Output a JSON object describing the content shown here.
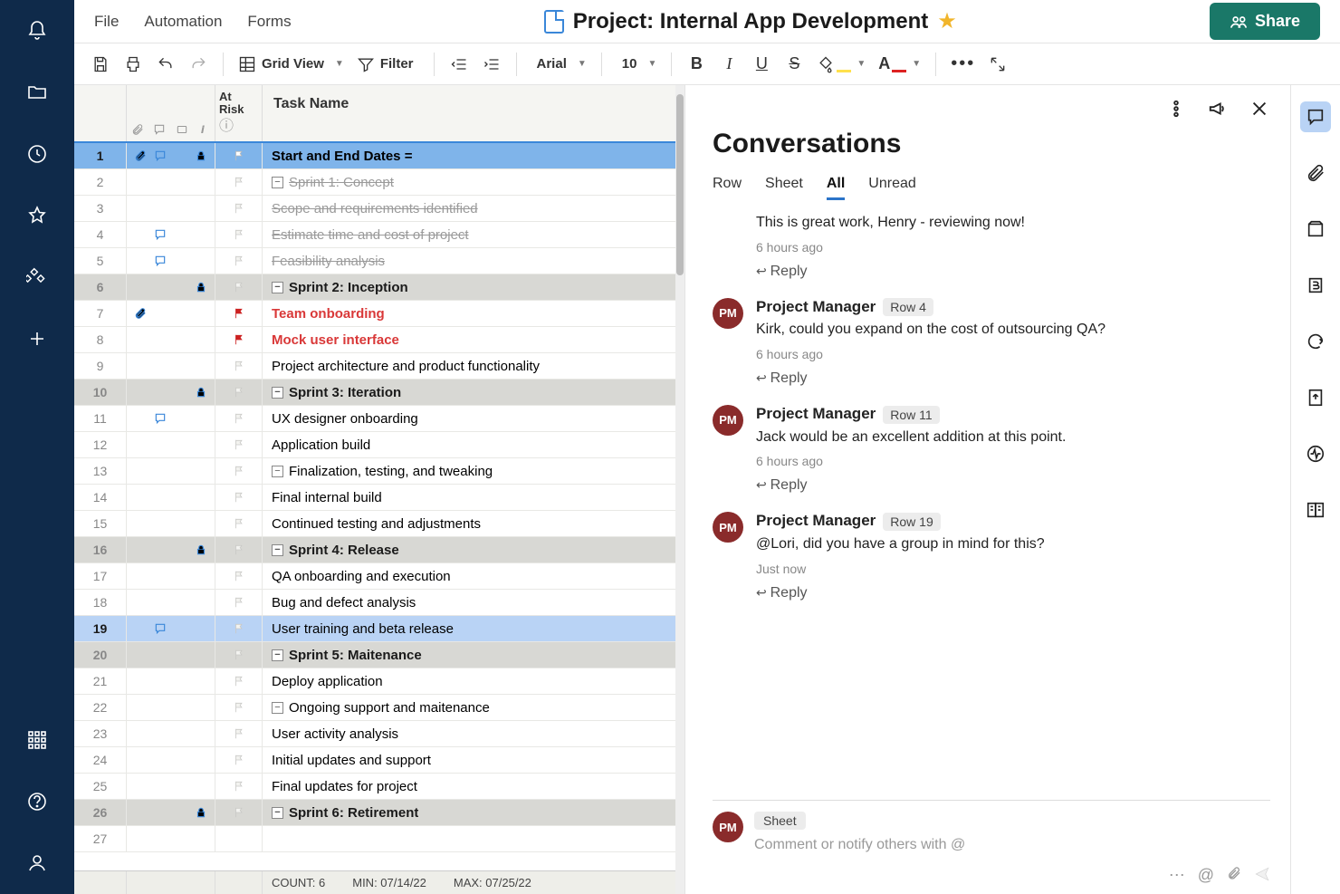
{
  "menu": {
    "file": "File",
    "automation": "Automation",
    "forms": "Forms"
  },
  "title": "Project: Internal App Development",
  "share": "Share",
  "toolbar": {
    "gridview": "Grid View",
    "filter": "Filter",
    "font": "Arial",
    "size": "10"
  },
  "gridHeaders": {
    "risk": "At Risk",
    "task": "Task Name"
  },
  "rows": [
    {
      "n": 1,
      "text": "Start and End Dates =",
      "style": "selected-blue",
      "indent": 0,
      "bold": true,
      "attach": true,
      "comment": true,
      "lock": true,
      "flag": "white",
      "exp": null
    },
    {
      "n": 2,
      "text": "Sprint 1: Concept",
      "style": "",
      "indent": 1,
      "strike": true,
      "exp": "-",
      "flag": "outline"
    },
    {
      "n": 3,
      "text": "Scope and requirements identified",
      "style": "",
      "indent": 2,
      "strike": true,
      "flag": "outline"
    },
    {
      "n": 4,
      "text": "Estimate time and cost of project",
      "style": "",
      "indent": 2,
      "strike": true,
      "comment": true,
      "flag": "outline"
    },
    {
      "n": 5,
      "text": "Feasibility analysis",
      "style": "",
      "indent": 2,
      "strike": true,
      "comment": true,
      "flag": "outline"
    },
    {
      "n": 6,
      "text": "Sprint 2: Inception",
      "style": "hdr",
      "indent": 1,
      "bold": true,
      "lock": true,
      "exp": "-",
      "flag": "outline"
    },
    {
      "n": 7,
      "text": "Team onboarding",
      "style": "",
      "indent": 2,
      "red": true,
      "attach": true,
      "flag": "red"
    },
    {
      "n": 8,
      "text": "Mock user interface",
      "style": "",
      "indent": 2,
      "red": true,
      "flag": "red"
    },
    {
      "n": 9,
      "text": "Project architecture and product functionality",
      "style": "",
      "indent": 2,
      "flag": "outline"
    },
    {
      "n": 10,
      "text": "Sprint 3: Iteration",
      "style": "hdr",
      "indent": 1,
      "bold": true,
      "lock": true,
      "exp": "-",
      "flag": "outline"
    },
    {
      "n": 11,
      "text": "UX designer onboarding",
      "style": "",
      "indent": 2,
      "comment": true,
      "flag": "outline"
    },
    {
      "n": 12,
      "text": "Application build",
      "style": "",
      "indent": 2,
      "flag": "outline"
    },
    {
      "n": 13,
      "text": "Finalization, testing, and tweaking",
      "style": "",
      "indent": 2,
      "exp": "-",
      "flag": "outline"
    },
    {
      "n": 14,
      "text": "Final internal build",
      "style": "",
      "indent": 3,
      "flag": "outline"
    },
    {
      "n": 15,
      "text": "Continued testing and adjustments",
      "style": "",
      "indent": 3,
      "flag": "outline"
    },
    {
      "n": 16,
      "text": "Sprint 4: Release",
      "style": "hdr",
      "indent": 1,
      "bold": true,
      "lock": true,
      "exp": "-",
      "flag": "outline"
    },
    {
      "n": 17,
      "text": "QA onboarding and execution",
      "style": "",
      "indent": 2,
      "flag": "outline"
    },
    {
      "n": 18,
      "text": "Bug and defect analysis",
      "style": "",
      "indent": 2,
      "flag": "outline"
    },
    {
      "n": 19,
      "text": "User training and beta release",
      "style": "current",
      "indent": 2,
      "comment": true,
      "flag": "outline"
    },
    {
      "n": 20,
      "text": "Sprint 5: Maitenance",
      "style": "hdr",
      "indent": 1,
      "bold": true,
      "exp": "-",
      "flag": "outline"
    },
    {
      "n": 21,
      "text": "Deploy application",
      "style": "",
      "indent": 2,
      "flag": "outline"
    },
    {
      "n": 22,
      "text": "Ongoing support and maitenance",
      "style": "",
      "indent": 2,
      "exp": "-",
      "flag": "outline"
    },
    {
      "n": 23,
      "text": "User activity analysis",
      "style": "",
      "indent": 3,
      "flag": "outline"
    },
    {
      "n": 24,
      "text": "Initial updates and support",
      "style": "",
      "indent": 3,
      "flag": "outline"
    },
    {
      "n": 25,
      "text": "Final updates for project",
      "style": "",
      "indent": 2,
      "flag": "outline"
    },
    {
      "n": 26,
      "text": "Sprint 6: Retirement",
      "style": "hdr",
      "indent": 1,
      "bold": true,
      "lock": true,
      "exp": "-",
      "flag": "outline"
    },
    {
      "n": 27,
      "text": "",
      "style": "",
      "indent": 2
    }
  ],
  "footer": {
    "count": "COUNT:  6",
    "min": "MIN:  07/14/22",
    "max": "MAX:  07/25/22"
  },
  "conversations": {
    "title": "Conversations",
    "tabs": {
      "row": "Row",
      "sheet": "Sheet",
      "all": "All",
      "unread": "Unread"
    },
    "replyLabel": "Reply",
    "messages": [
      {
        "name": "",
        "chip": "",
        "text": "This is great work, Henry - reviewing now!",
        "time": "6 hours ago",
        "half": true
      },
      {
        "name": "Project Manager",
        "chip": "Row 4",
        "text": "Kirk, could you expand on the cost of outsourcing QA?",
        "time": "6 hours ago",
        "av": "PM"
      },
      {
        "name": "Project Manager",
        "chip": "Row 11",
        "text": "Jack would be an excellent addition at this point.",
        "time": "6 hours ago",
        "av": "PM"
      },
      {
        "name": "Project Manager",
        "chip": "Row 19",
        "text": "@Lori, did you have a group in mind for this?",
        "time": "Just now",
        "av": "PM"
      }
    ],
    "compose": {
      "chip": "Sheet",
      "placeholder": "Comment or notify others with @",
      "av": "PM"
    }
  }
}
